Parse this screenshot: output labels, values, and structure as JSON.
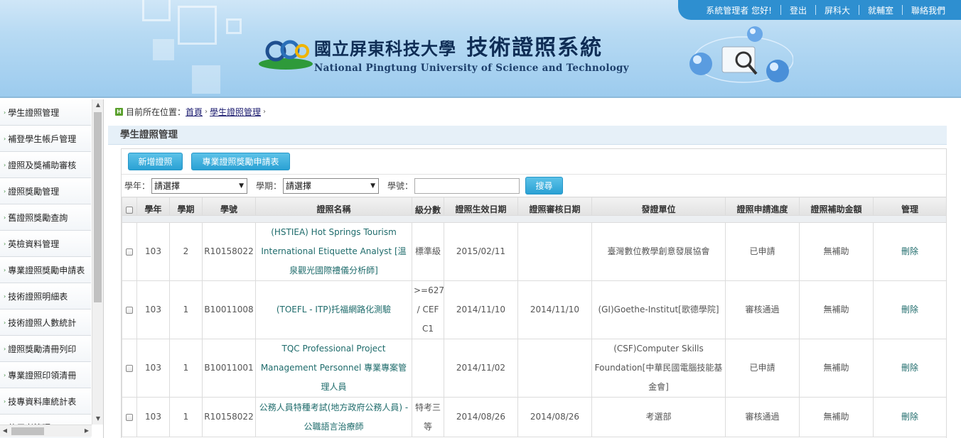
{
  "header": {
    "top_links": [
      "系統管理者 您好!",
      "登出",
      "屏科大",
      "就輔室",
      "聯絡我們"
    ],
    "title_zh_school": "國立屏東科技大學",
    "title_zh_system": "技術證照系統",
    "title_en": "National Pingtung University of Science and Technology"
  },
  "sidebar": {
    "items": [
      "學生證照管理",
      "補登學生帳戶管理",
      "證照及獎補助審核",
      "證照獎勵管理",
      "舊證照獎勵查詢",
      "英檢資料管理",
      "專業證照獎勵申請表",
      "技術證照明細表",
      "技術證照人數統計",
      "證照獎勵清冊列印",
      "專業證照印領清冊",
      "技專資料庫統計表",
      "使用者管理"
    ]
  },
  "breadcrumb": {
    "prefix": "目前所在位置：",
    "home": "首頁",
    "current": "學生證照管理"
  },
  "section_title": "學生證照管理",
  "toolbar": {
    "add_label": "新增證照",
    "form_label": "專業證照獎勵申請表"
  },
  "filters": {
    "year_label": "學年：",
    "year_value": "請選擇",
    "term_label": "學期：",
    "term_value": "請選擇",
    "id_label": "學號：",
    "id_value": "",
    "search_label": "搜尋"
  },
  "table": {
    "columns": [
      "學年",
      "學期",
      "學號",
      "證照名稱",
      "級分數",
      "證照生效日期",
      "證照審核日期",
      "發證單位",
      "證照申請進度",
      "證照補助金額",
      "管理"
    ],
    "rows": [
      {
        "year": "103",
        "term": "2",
        "id": "R10158022",
        "cert": "(HSTIEA) Hot Springs Tourism International Etiquette Analyst [溫泉觀光國際禮儀分析師]",
        "level": "標準級",
        "eff": "2015/02/11",
        "rev": "",
        "issuer": "臺灣數位教學創意發展協會",
        "status": "已申請",
        "amount": "無補助",
        "action": "刪除"
      },
      {
        "year": "103",
        "term": "1",
        "id": "B10011008",
        "cert": "(TOEFL - ITP)托福網路化測驗",
        "level": ">=627 / CEF C1",
        "eff": "2014/11/10",
        "rev": "2014/11/10",
        "issuer": "(GI)Goethe-Institut[歌德學院]",
        "status": "審核通過",
        "amount": "無補助",
        "action": "刪除"
      },
      {
        "year": "103",
        "term": "1",
        "id": "B10011001",
        "cert": "TQC Professional Project Management Personnel 專業專案管理人員",
        "level": "",
        "eff": "2014/11/02",
        "rev": "",
        "issuer": "(CSF)Computer Skills Foundation[中華民國電腦技能基金會]",
        "status": "已申請",
        "amount": "無補助",
        "action": "刪除"
      },
      {
        "year": "103",
        "term": "1",
        "id": "R10158022",
        "cert": "公務人員特種考試(地方政府公務人員) - 公職語言治療師",
        "level": "特考三等",
        "eff": "2014/08/26",
        "rev": "2014/08/26",
        "issuer": "考選部",
        "status": "審核通過",
        "amount": "無補助",
        "action": "刪除"
      }
    ]
  }
}
